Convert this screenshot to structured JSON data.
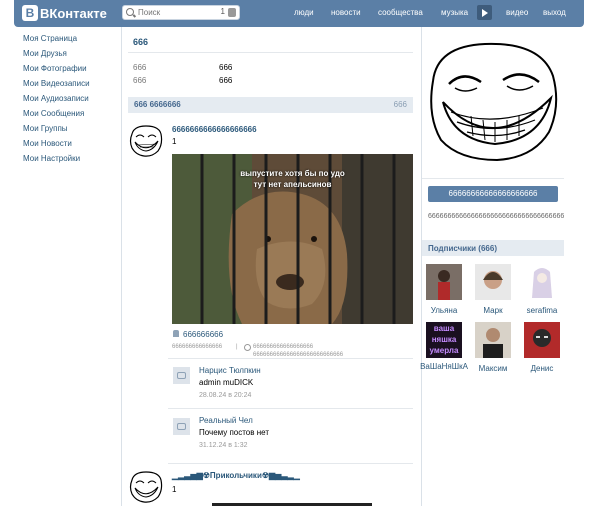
{
  "header": {
    "logo": "ВКонтакте",
    "search_placeholder": "Поиск",
    "search_count": "1",
    "nav": [
      "люди",
      "новости",
      "сообщества",
      "музыка",
      "видео",
      "выход"
    ]
  },
  "left_menu": [
    "Моя Страница",
    "Мои Друзья",
    "Мои Фотографии",
    "Мои Видеозаписи",
    "Мои Аудиозаписи",
    "Мои Сообщения",
    "Мои Группы",
    "Мои Новости",
    "Мои Настройки"
  ],
  "profile": {
    "name": "666",
    "info": [
      {
        "label": "666",
        "value": "666"
      },
      {
        "label": "666",
        "value": "666"
      }
    ]
  },
  "wall": {
    "title": "666 6666666",
    "count": "666",
    "post1": {
      "author": "6666666666666666666",
      "text": "1",
      "photo_caption_1": "выпустите хотя бы по удо",
      "photo_caption_2": "тут нет апельсинов",
      "likes": "666666666",
      "meta_date": "666666666666666",
      "meta_sep": "|",
      "meta_link_1": "666666666666666666",
      "meta_link_2": "666666666666666666666666666"
    },
    "comments": [
      {
        "name": "Нарцис Тюлпкин",
        "text": "admin muDICK",
        "date": "28.08.24 в 20:24"
      },
      {
        "name": "Реальный Чел",
        "text": "Почему постов нет",
        "date": "31.12.24 в 1:32"
      }
    ],
    "post2": {
      "author": "▁▂▃▅▆☢Прикольчики☢▆▅▃▂▁",
      "text": "1"
    }
  },
  "right": {
    "button": "66666666666666666666",
    "text": "666666666666666666666666666666666666666666",
    "subscribers_title": "Подписчики (666)",
    "subscribers": [
      {
        "name": "Ульяна"
      },
      {
        "name": "Марк"
      },
      {
        "name": "serafima"
      },
      {
        "name": "ВаШаНяШкА"
      },
      {
        "name": "Максим"
      },
      {
        "name": "Денис"
      }
    ],
    "vashanyashka_label_1": "ваша",
    "vashanyashka_label_2": "няшка",
    "vashanyashka_label_3": "умерла"
  },
  "colors": {
    "header": "#5b7fa6",
    "link": "#2b587a",
    "panel": "#e5ebf1"
  }
}
